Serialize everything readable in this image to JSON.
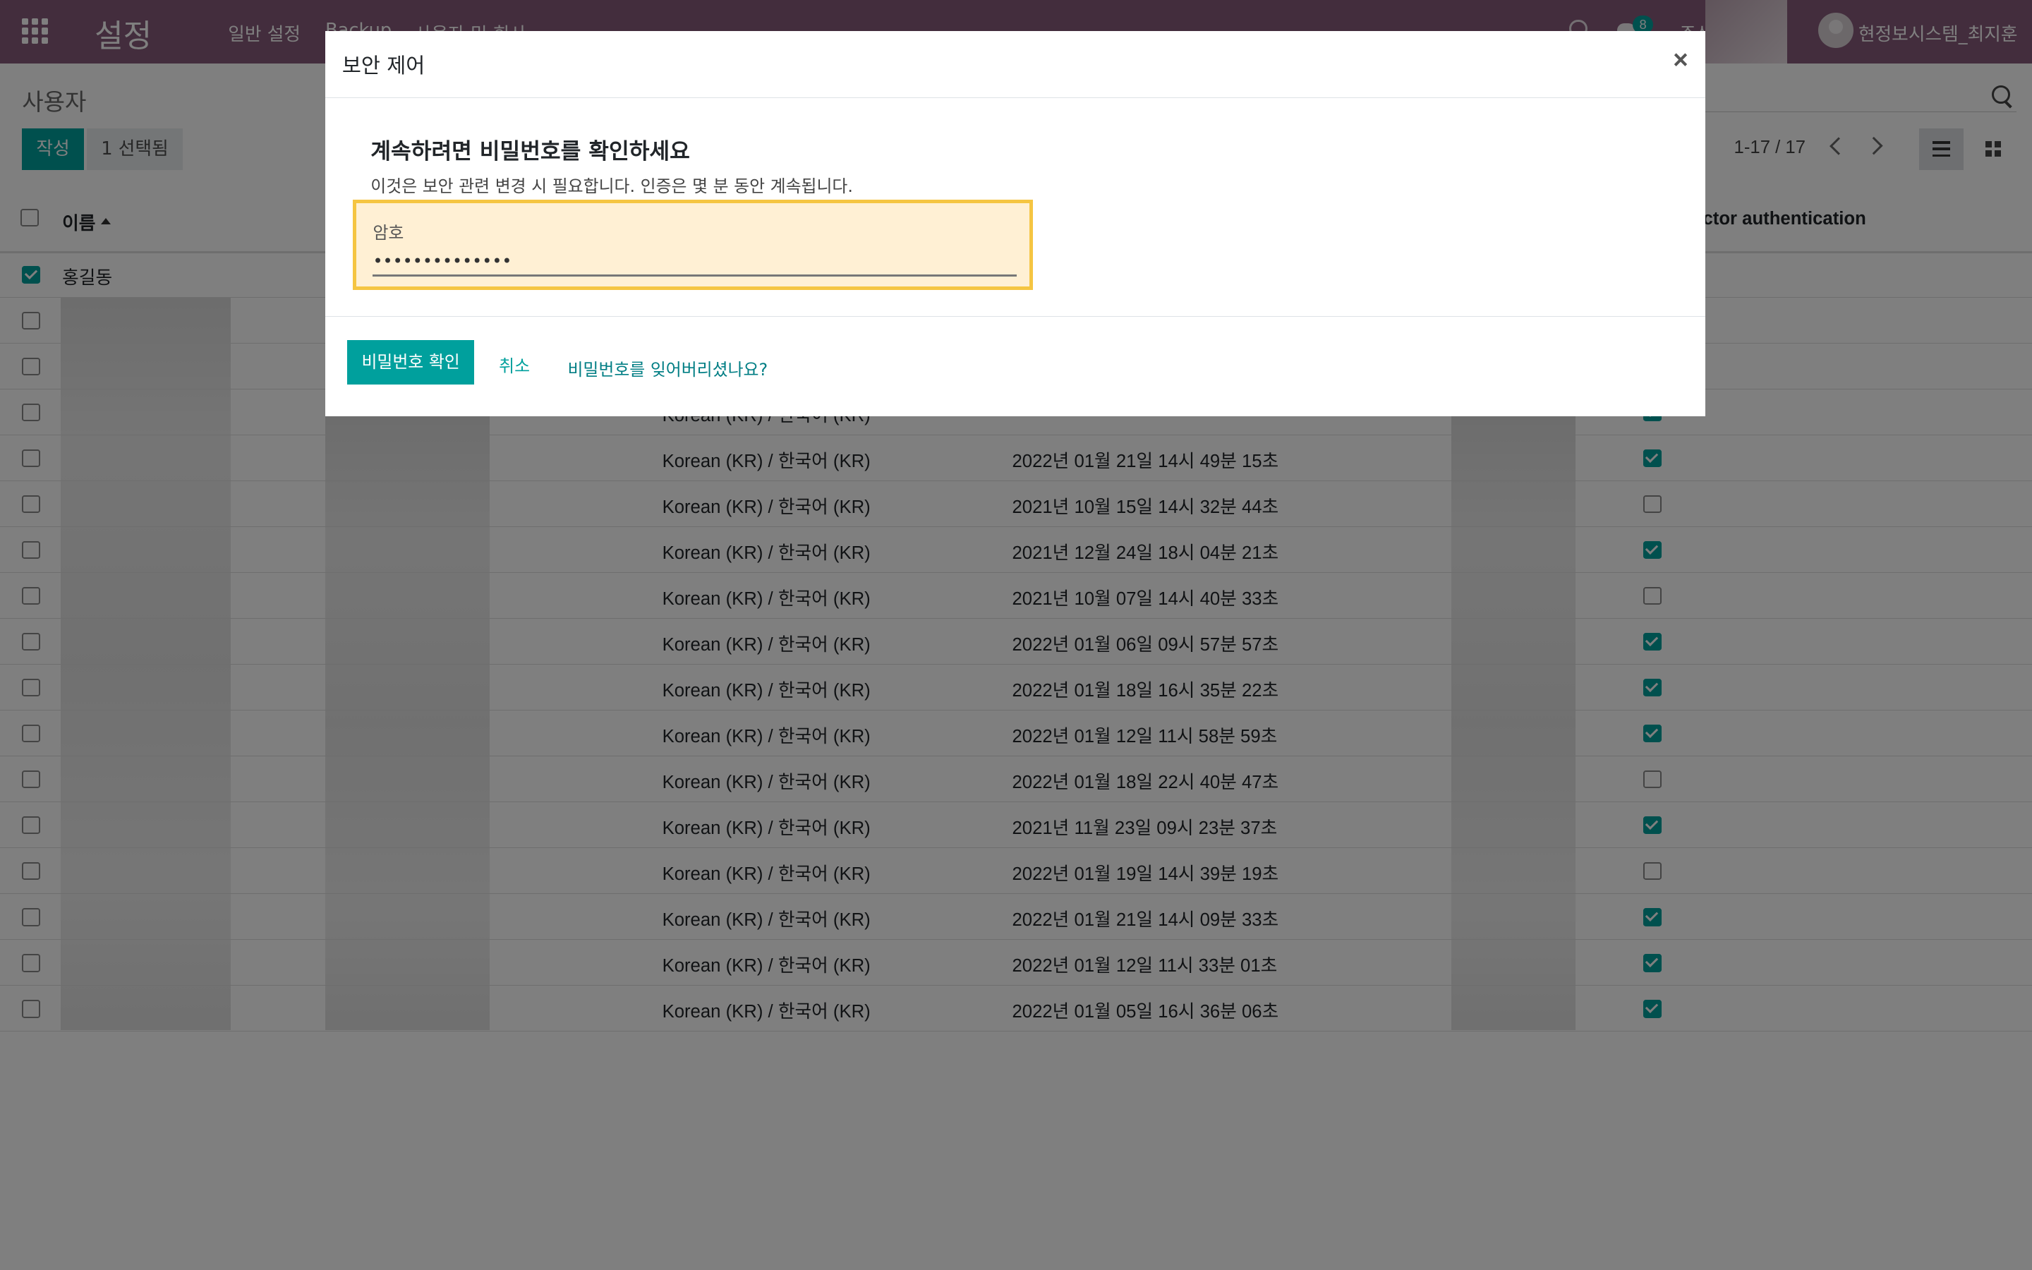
{
  "navbar": {
    "brand": "설정",
    "menu": [
      "일반 설정",
      "Backup",
      "사용자 및 회사"
    ],
    "notification_count": "8",
    "company_partial": "주식",
    "user_name": "현정보시스템_최지훈"
  },
  "control_panel": {
    "breadcrumb": "사용자",
    "create_label": "작성",
    "selected_label": "1 선택됨",
    "pager_value": "1-17 / 17"
  },
  "list": {
    "header_name": "이름",
    "header_2fa": "ctor authentication",
    "first_row_name": "홍길동",
    "rows": [
      {
        "selected": true,
        "name": "홍길동",
        "lang": "",
        "login": "",
        "tfa": null
      },
      {
        "selected": false,
        "name": "",
        "lang": "",
        "login": "",
        "tfa": null
      },
      {
        "selected": false,
        "name": "",
        "lang": "",
        "login": "",
        "tfa": null
      },
      {
        "selected": false,
        "name": "",
        "lang": "Korean (KR) / 한국어 (KR)",
        "login": "",
        "tfa": true
      },
      {
        "selected": false,
        "name": "",
        "lang": "Korean (KR) / 한국어 (KR)",
        "login": "2022년 01월 21일 14시 49분 15초",
        "tfa": true
      },
      {
        "selected": false,
        "name": "",
        "lang": "Korean (KR) / 한국어 (KR)",
        "login": "2021년 10월 15일 14시 32분 44초",
        "tfa": false
      },
      {
        "selected": false,
        "name": "",
        "lang": "Korean (KR) / 한국어 (KR)",
        "login": "2021년 12월 24일 18시 04분 21초",
        "tfa": true
      },
      {
        "selected": false,
        "name": "",
        "lang": "Korean (KR) / 한국어 (KR)",
        "login": "2021년 10월 07일 14시 40분 33초",
        "tfa": false
      },
      {
        "selected": false,
        "name": "",
        "lang": "Korean (KR) / 한국어 (KR)",
        "login": "2022년 01월 06일 09시 57분 57초",
        "tfa": true
      },
      {
        "selected": false,
        "name": "",
        "lang": "Korean (KR) / 한국어 (KR)",
        "login": "2022년 01월 18일 16시 35분 22초",
        "tfa": true
      },
      {
        "selected": false,
        "name": "",
        "lang": "Korean (KR) / 한국어 (KR)",
        "login": "2022년 01월 12일 11시 58분 59초",
        "tfa": true
      },
      {
        "selected": false,
        "name": "",
        "lang": "Korean (KR) / 한국어 (KR)",
        "login": "2022년 01월 18일 22시 40분 47초",
        "tfa": false
      },
      {
        "selected": false,
        "name": "",
        "lang": "Korean (KR) / 한국어 (KR)",
        "login": "2021년 11월 23일 09시 23분 37초",
        "tfa": true
      },
      {
        "selected": false,
        "name": "",
        "lang": "Korean (KR) / 한국어 (KR)",
        "login": "2022년 01월 19일 14시 39분 19초",
        "tfa": false
      },
      {
        "selected": false,
        "name": "",
        "lang": "Korean (KR) / 한국어 (KR)",
        "login": "2022년 01월 21일 14시 09분 33초",
        "tfa": true
      },
      {
        "selected": false,
        "name": "",
        "lang": "Korean (KR) / 한국어 (KR)",
        "login": "2022년 01월 12일 11시 33분 01초",
        "tfa": true
      },
      {
        "selected": false,
        "name": "",
        "lang": "Korean (KR) / 한국어 (KR)",
        "login": "2022년 01월 05일 16시 36분 06초",
        "tfa": true
      }
    ]
  },
  "modal": {
    "title": "보안 제어",
    "close_label": "×",
    "heading": "계속하려면 비밀번호를 확인하세요",
    "subtext": "이것은 보안 관련 변경 시 필요합니다. 인증은 몇 분 동안 계속됩니다.",
    "password_label": "암호",
    "password_value": "••••••••••••••",
    "confirm_label": "비밀번호 확인",
    "cancel_label": "취소",
    "forgot_label": "비밀번호를 잊어버리셨나요?"
  },
  "colors": {
    "navbar": "#875A7B",
    "primary": "#00A09D",
    "highlight_border": "#f5c542",
    "highlight_bg": "#fff0d4"
  }
}
